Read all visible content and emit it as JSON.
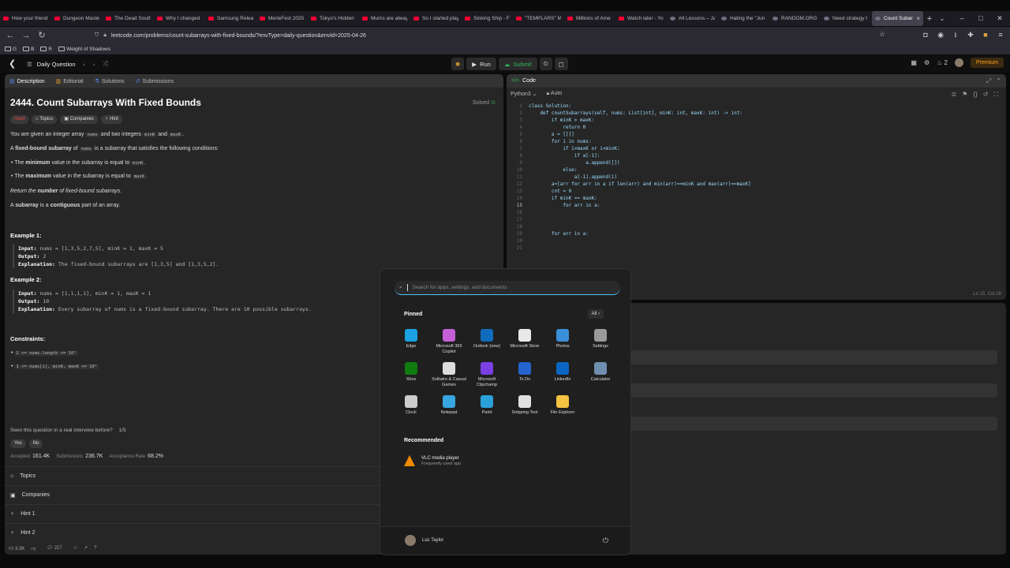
{
  "browser": {
    "tabs": [
      {
        "label": "How your friend",
        "icon": "youtube-icon"
      },
      {
        "label": "Dungeon Maste",
        "icon": "youtube-icon"
      },
      {
        "label": "The Dead South",
        "icon": "youtube-icon"
      },
      {
        "label": "Why I changed",
        "icon": "youtube-icon"
      },
      {
        "label": "Samsung Releas",
        "icon": "youtube-icon"
      },
      {
        "label": "MerleFest 2025",
        "icon": "youtube-icon"
      },
      {
        "label": "Tokyo's Hidden",
        "icon": "youtube-icon"
      },
      {
        "label": "Mums are alway",
        "icon": "youtube-icon"
      },
      {
        "label": "So I started play",
        "icon": "youtube-icon"
      },
      {
        "label": "Sinking Ship - F",
        "icon": "youtube-icon"
      },
      {
        "label": "\"TEMPLARS\" M",
        "icon": "youtube-icon"
      },
      {
        "label": "Millions of Ame",
        "icon": "youtube-icon"
      },
      {
        "label": "Watch later - Yo",
        "icon": "youtube-icon"
      },
      {
        "label": "All Lessons – Ja",
        "icon": "globe-icon"
      },
      {
        "label": "Hating the \"Jun",
        "icon": "globe-icon"
      },
      {
        "label": "RANDOM.ORG",
        "icon": "globe-icon"
      },
      {
        "label": "Need strategy t",
        "icon": "globe-icon"
      },
      {
        "label": "Count Subarr",
        "icon": "leetcode-icon",
        "active": true
      }
    ],
    "url": "leetcode.com/problems/count-subarrays-with-fixed-bounds/?envType=daily-question&envId=2025-04-26",
    "bookmarks": [
      "G",
      "B",
      "R",
      "Weight of Shadows"
    ]
  },
  "lc_header": {
    "title": "Daily Question",
    "run_label": "Run",
    "submit_label": "Submit",
    "streak": "2",
    "premium_label": "Premium"
  },
  "problem": {
    "tabs": [
      "Description",
      "Editorial",
      "Solutions",
      "Submissions"
    ],
    "title": "2444. Count Subarrays With Fixed Bounds",
    "solved_label": "Solved",
    "chips": [
      "Hard",
      "Topics",
      "Companies",
      "Hint"
    ],
    "intro_1": "You are given an integer array",
    "intro_nums": "nums",
    "intro_2": "and two integers",
    "intro_mink": "minK",
    "intro_and": "and",
    "intro_maxk": "maxK",
    "intro_end": ".",
    "fixed_a": "A",
    "fixed_bold": "fixed-bound subarray",
    "fixed_of": "of",
    "fixed_nums": "nums",
    "fixed_rest": "is a subarray that satisfies the following conditions:",
    "cond1_pre": "The",
    "cond1_bold": "minimum",
    "cond1_post": "value in the subarray is equal to",
    "cond1_code": "minK",
    "cond2_pre": "The",
    "cond2_bold": "maximum",
    "cond2_post": "value in the subarray is equal to",
    "cond2_code": "maxK",
    "return_1": "Return the",
    "return_bold": "number",
    "return_2": "of fixed-bound subarrays.",
    "sub_a": "A",
    "sub_bold1": "subarray",
    "sub_is": "is a",
    "sub_bold2": "contiguous",
    "sub_rest": "part of an array.",
    "ex1_title": "Example 1:",
    "ex1_input_label": "Input:",
    "ex1_input": "nums = [1,3,5,2,7,5], minK = 1, maxK = 5",
    "ex1_output_label": "Output:",
    "ex1_output": "2",
    "ex1_expl_label": "Explanation:",
    "ex1_expl": "The fixed-bound subarrays are [1,3,5] and [1,3,5,2].",
    "ex2_title": "Example 2:",
    "ex2_input_label": "Input:",
    "ex2_input": "nums = [1,1,1,1], minK = 1, maxK = 1",
    "ex2_output_label": "Output:",
    "ex2_output": "10",
    "ex2_expl_label": "Explanation:",
    "ex2_expl": "Every subarray of nums is a fixed-bound subarray. There are 10 possible subarrays.",
    "constraints_title": "Constraints:",
    "constraint1": "2 <= nums.length <= 10⁵",
    "constraint2": "1 <= nums[i], minK, maxK <= 10⁶",
    "seen_q": "Seen this question in a real interview before?",
    "seen_count": "1/5",
    "yes": "Yes",
    "no": "No",
    "accepted_label": "Accepted",
    "accepted": "161.4K",
    "submissions_label": "Submissions",
    "submissions": "236.7K",
    "rate_label": "Acceptance Rate",
    "rate": "68.2%",
    "sections": [
      "Topics",
      "Companies",
      "Hint 1",
      "Hint 2"
    ],
    "likes": "3.3K",
    "comments": "217"
  },
  "code": {
    "tab_label": "Code",
    "language": "Python3",
    "autosave": "Auto",
    "lines": [
      "class Solution:",
      "    def countSubarrays(self, nums: List[int], minK: int, maxK: int) -> int:",
      "        if minK > maxK:",
      "            return 0",
      "        a = [[]]",
      "        for i in nums:",
      "            if i>maxK or i<minK:",
      "                if a[-1]:",
      "                    a.append([])",
      "            else:",
      "                a[-1].append(i)",
      "        a=[arr for arr in a if len(arr) and min(arr)==minK and max(arr)==maxK]",
      "        cnt = 0",
      "        if minK == maxK:",
      "            for arr in a:",
      "",
      "",
      "",
      "        for arr in a:",
      "",
      ""
    ],
    "cursor": "Ln 15, Col 26"
  },
  "start_menu": {
    "search_placeholder": "Search for apps, settings, and documents",
    "pinned_label": "Pinned",
    "all_label": "All",
    "apps": [
      {
        "name": "Edge",
        "color": "#1ba1e2"
      },
      {
        "name": "Microsoft 365 Copilot",
        "color": "#c45fd6"
      },
      {
        "name": "Outlook (new)",
        "color": "#0f6cbd"
      },
      {
        "name": "Microsoft Store",
        "color": "#e8e8e8"
      },
      {
        "name": "Photos",
        "color": "#3a8fd9"
      },
      {
        "name": "Settings",
        "color": "#9a9a9a"
      },
      {
        "name": "Xbox",
        "color": "#107c10"
      },
      {
        "name": "Solitaire & Casual Games",
        "color": "#dddddd"
      },
      {
        "name": "Microsoft Clipchamp",
        "color": "#7b3fe4"
      },
      {
        "name": "To Do",
        "color": "#2564cf"
      },
      {
        "name": "LinkedIn",
        "color": "#0a66c2"
      },
      {
        "name": "Calculator",
        "color": "#6f8fb0"
      },
      {
        "name": "Clock",
        "color": "#cccccc"
      },
      {
        "name": "Notepad",
        "color": "#38a6e0"
      },
      {
        "name": "Paint",
        "color": "#2aa1d8"
      },
      {
        "name": "Snipping Tool",
        "color": "#e0e0e0"
      },
      {
        "name": "File Explorer",
        "color": "#f5c242"
      }
    ],
    "recommended_label": "Recommended",
    "rec_app": "VLC media player",
    "rec_sub": "Frequently used app",
    "user": "Luc Taylor"
  }
}
